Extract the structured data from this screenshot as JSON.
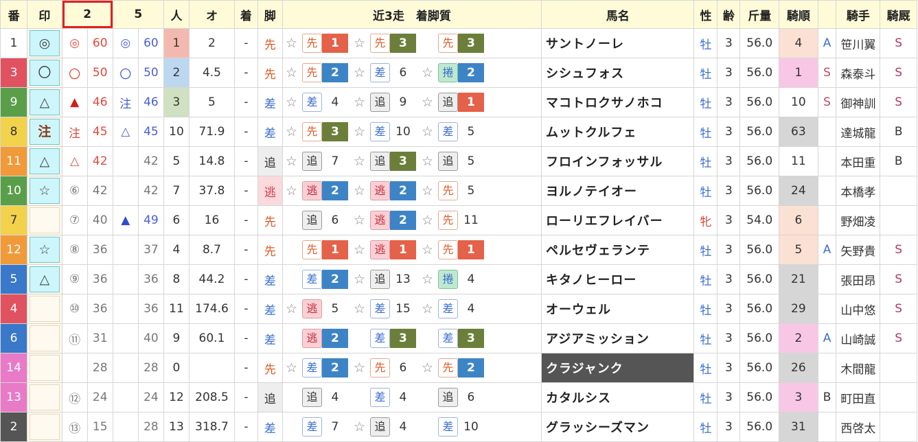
{
  "headers": {
    "ban": "番",
    "in": "印",
    "col2": "2",
    "col5": "5",
    "nin": "人",
    "odds": "オ",
    "chaku": "着",
    "kyaku": "脚",
    "recent": "近3走　着脚質",
    "horse": "馬名",
    "sex": "性",
    "age": "齢",
    "weight": "斤量",
    "rank": "騎順",
    "jockey": "騎手",
    "stable": "騎厩"
  },
  "rows": [
    {
      "ban": "1",
      "mark": "◎",
      "m2": "◎",
      "m2c": "red",
      "s2": "60",
      "m5": "◎",
      "m5c": "blue",
      "s5": "60",
      "pop": "1",
      "odds": "2",
      "chaku": "-",
      "leg": "先",
      "legc": "sen",
      "recent": [
        {
          "star": "☆",
          "style": "先",
          "sc": "sen",
          "pl": "1",
          "pc": "p1"
        },
        {
          "star": "☆",
          "style": "先",
          "sc": "sen",
          "pl": "3",
          "pc": "p3"
        },
        {
          "star": "",
          "style": "先",
          "sc": "sen",
          "pl": "3",
          "pc": "p3"
        }
      ],
      "horse": "サントノーレ",
      "sex": "牡",
      "age": "3",
      "weight": "56.0",
      "rank": "4",
      "rc": "o-peach",
      "letter": "A",
      "lc": "letA",
      "jockey": "笹川翼",
      "stable": "S",
      "stc": "stS"
    },
    {
      "ban": "3",
      "mark": "〇",
      "m2": "〇",
      "m2c": "red",
      "s2": "50",
      "m5": "〇",
      "m5c": "blue",
      "s5": "50",
      "pop": "2",
      "odds": "4.5",
      "chaku": "-",
      "leg": "先",
      "legc": "sen",
      "recent": [
        {
          "star": "☆",
          "style": "先",
          "sc": "sen",
          "pl": "2",
          "pc": "p2"
        },
        {
          "star": "☆",
          "style": "差",
          "sc": "sa",
          "pl": "6",
          "pc": ""
        },
        {
          "star": "☆",
          "style": "捲",
          "sc": "maki",
          "pl": "2",
          "pc": "p2"
        }
      ],
      "horse": "シシュフォス",
      "sex": "牡",
      "age": "3",
      "weight": "56.0",
      "rank": "1",
      "rc": "o-pink",
      "letter": "S",
      "lc": "letS",
      "jockey": "森泰斗",
      "stable": "S",
      "stc": "stS"
    },
    {
      "ban": "9",
      "mark": "△",
      "m2": "▲",
      "m2c": "red",
      "s2": "46",
      "m5": "注",
      "m5c": "blue",
      "s5": "46",
      "pop": "3",
      "odds": "5",
      "chaku": "-",
      "leg": "差",
      "legc": "sa",
      "recent": [
        {
          "star": "☆",
          "style": "差",
          "sc": "sa",
          "pl": "4",
          "pc": ""
        },
        {
          "star": "☆",
          "style": "追",
          "sc": "tsui",
          "pl": "9",
          "pc": ""
        },
        {
          "star": "☆",
          "style": "追",
          "sc": "tsui",
          "pl": "1",
          "pc": "p1"
        }
      ],
      "horse": "マコトロクサノホコ",
      "sex": "牡",
      "age": "3",
      "weight": "56.0",
      "rank": "10",
      "rc": "",
      "letter": "S",
      "lc": "letS",
      "jockey": "御神訓",
      "stable": "S",
      "stc": "stS"
    },
    {
      "ban": "8",
      "mark": "注",
      "m2": "注",
      "m2c": "red",
      "s2": "45",
      "m5": "△",
      "m5c": "blue",
      "s5": "45",
      "pop": "10",
      "odds": "71.9",
      "chaku": "-",
      "leg": "差",
      "legc": "sa",
      "recent": [
        {
          "star": "☆",
          "style": "先",
          "sc": "sen",
          "pl": "3",
          "pc": "p3"
        },
        {
          "star": "☆",
          "style": "差",
          "sc": "sa",
          "pl": "10",
          "pc": ""
        },
        {
          "star": "☆",
          "style": "差",
          "sc": "sa",
          "pl": "5",
          "pc": ""
        }
      ],
      "horse": "ムットクルフェ",
      "sex": "牡",
      "age": "3",
      "weight": "56.0",
      "rank": "63",
      "rc": "o-gray",
      "letter": "",
      "lc": "letB",
      "jockey": "達城龍",
      "stable": "B",
      "stc": "stB"
    },
    {
      "ban": "11",
      "mark": "△",
      "m2": "△",
      "m2c": "red",
      "s2": "42",
      "m5": "",
      "m5c": "blue",
      "s5": "42",
      "pop": "5",
      "odds": "14.8",
      "chaku": "-",
      "leg": "追",
      "legc": "tsui",
      "recent": [
        {
          "star": "☆",
          "style": "追",
          "sc": "tsui",
          "pl": "7",
          "pc": ""
        },
        {
          "star": "☆",
          "style": "追",
          "sc": "tsui",
          "pl": "3",
          "pc": "p3"
        },
        {
          "star": "☆",
          "style": "追",
          "sc": "tsui",
          "pl": "5",
          "pc": ""
        }
      ],
      "horse": "フロインフォッサル",
      "sex": "牡",
      "age": "3",
      "weight": "56.0",
      "rank": "11",
      "rc": "",
      "letter": "",
      "lc": "letB",
      "jockey": "本田重",
      "stable": "B",
      "stc": "stB"
    },
    {
      "ban": "10",
      "mark": "☆",
      "m2": "⑥",
      "m2c": "gray",
      "s2": "42",
      "m5": "",
      "m5c": "blue",
      "s5": "42",
      "pop": "7",
      "odds": "37.8",
      "chaku": "-",
      "leg": "逃",
      "legc": "nige",
      "recent": [
        {
          "star": "☆",
          "style": "逃",
          "sc": "nige",
          "pl": "2",
          "pc": "p2"
        },
        {
          "star": "☆",
          "style": "逃",
          "sc": "nige",
          "pl": "2",
          "pc": "p2"
        },
        {
          "star": "☆",
          "style": "先",
          "sc": "sen",
          "pl": "5",
          "pc": ""
        }
      ],
      "horse": "ヨルノテイオー",
      "sex": "牡",
      "age": "3",
      "weight": "56.0",
      "rank": "24",
      "rc": "o-gray",
      "letter": "",
      "lc": "letB",
      "jockey": "本橋孝",
      "stable": "",
      "stc": "stB"
    },
    {
      "ban": "7",
      "mark": "",
      "m2": "⑦",
      "m2c": "gray",
      "s2": "40",
      "m5": "▲",
      "m5c": "blue",
      "s5": "49",
      "pop": "6",
      "odds": "16",
      "chaku": "-",
      "leg": "先",
      "legc": "sen",
      "recent": [
        {
          "star": "",
          "style": "追",
          "sc": "tsui",
          "pl": "6",
          "pc": ""
        },
        {
          "star": "☆",
          "style": "逃",
          "sc": "nige",
          "pl": "2",
          "pc": "p2"
        },
        {
          "star": "☆",
          "style": "先",
          "sc": "sen",
          "pl": "11",
          "pc": ""
        }
      ],
      "horse": "ローリエフレイバー",
      "sex": "牝",
      "age": "3",
      "weight": "54.0",
      "rank": "6",
      "rc": "o-peach",
      "letter": "",
      "lc": "letB",
      "jockey": "野畑凌",
      "stable": "",
      "stc": "stB"
    },
    {
      "ban": "12",
      "mark": "☆",
      "m2": "⑧",
      "m2c": "gray",
      "s2": "36",
      "m5": "",
      "m5c": "blue",
      "s5": "37",
      "pop": "4",
      "odds": "8.7",
      "chaku": "-",
      "leg": "先",
      "legc": "sen",
      "recent": [
        {
          "star": "",
          "style": "先",
          "sc": "sen",
          "pl": "1",
          "pc": "p1"
        },
        {
          "star": "☆",
          "style": "逃",
          "sc": "nige",
          "pl": "1",
          "pc": "p1"
        },
        {
          "star": "☆",
          "style": "先",
          "sc": "sen",
          "pl": "1",
          "pc": "p1"
        }
      ],
      "horse": "ペルセヴェランテ",
      "sex": "牡",
      "age": "3",
      "weight": "56.0",
      "rank": "5",
      "rc": "o-peach",
      "letter": "A",
      "lc": "letA",
      "jockey": "矢野貴",
      "stable": "S",
      "stc": "stS"
    },
    {
      "ban": "5",
      "mark": "△",
      "m2": "⑨",
      "m2c": "gray",
      "s2": "36",
      "m5": "",
      "m5c": "blue",
      "s5": "36",
      "pop": "8",
      "odds": "44.2",
      "chaku": "-",
      "leg": "差",
      "legc": "sa",
      "recent": [
        {
          "star": "",
          "style": "差",
          "sc": "sa",
          "pl": "2",
          "pc": "p2"
        },
        {
          "star": "☆",
          "style": "追",
          "sc": "tsui",
          "pl": "13",
          "pc": ""
        },
        {
          "star": "☆",
          "style": "捲",
          "sc": "maki",
          "pl": "4",
          "pc": ""
        }
      ],
      "horse": "キタノヒーロー",
      "sex": "牡",
      "age": "3",
      "weight": "56.0",
      "rank": "21",
      "rc": "o-gray",
      "letter": "",
      "lc": "letB",
      "jockey": "張田昂",
      "stable": "S",
      "stc": "stS"
    },
    {
      "ban": "4",
      "mark": "",
      "m2": "⑩",
      "m2c": "gray",
      "s2": "36",
      "m5": "",
      "m5c": "blue",
      "s5": "36",
      "pop": "11",
      "odds": "174.6",
      "chaku": "-",
      "leg": "差",
      "legc": "sa",
      "recent": [
        {
          "star": "☆",
          "style": "逃",
          "sc": "nige",
          "pl": "5",
          "pc": ""
        },
        {
          "star": "☆",
          "style": "差",
          "sc": "sa",
          "pl": "15",
          "pc": ""
        },
        {
          "star": "☆",
          "style": "差",
          "sc": "sa",
          "pl": "4",
          "pc": ""
        }
      ],
      "horse": "オーウェル",
      "sex": "牡",
      "age": "3",
      "weight": "56.0",
      "rank": "29",
      "rc": "o-gray",
      "letter": "",
      "lc": "letB",
      "jockey": "山中悠",
      "stable": "S",
      "stc": "stS"
    },
    {
      "ban": "6",
      "mark": "",
      "m2": "⑪",
      "m2c": "gray",
      "s2": "31",
      "m5": "",
      "m5c": "blue",
      "s5": "40",
      "pop": "9",
      "odds": "60.1",
      "chaku": "-",
      "leg": "差",
      "legc": "sa",
      "recent": [
        {
          "star": "",
          "style": "逃",
          "sc": "nige",
          "pl": "2",
          "pc": "p2"
        },
        {
          "star": "",
          "style": "差",
          "sc": "sa",
          "pl": "3",
          "pc": "p3"
        },
        {
          "star": "",
          "style": "差",
          "sc": "sa",
          "pl": "3",
          "pc": "p3"
        }
      ],
      "horse": "アジアミッション",
      "sex": "牡",
      "age": "3",
      "weight": "56.0",
      "rank": "2",
      "rc": "o-pink",
      "letter": "A",
      "lc": "letA",
      "jockey": "山崎誠",
      "stable": "S",
      "stc": "stS"
    },
    {
      "ban": "14",
      "mark": "",
      "m2": "",
      "m2c": "gray",
      "s2": "28",
      "m5": "",
      "m5c": "blue",
      "s5": "28",
      "pop": "0",
      "odds": "",
      "chaku": "-",
      "leg": "先",
      "legc": "sen",
      "recent": [
        {
          "star": "☆",
          "style": "差",
          "sc": "sa",
          "pl": "2",
          "pc": "p2"
        },
        {
          "star": "☆",
          "style": "先",
          "sc": "sen",
          "pl": "6",
          "pc": ""
        },
        {
          "star": "☆",
          "style": "先",
          "sc": "sen",
          "pl": "2",
          "pc": "p2"
        }
      ],
      "horse": "クラジャンク",
      "sex": "牡",
      "age": "3",
      "weight": "56.0",
      "rank": "26",
      "rc": "o-gray",
      "letter": "",
      "lc": "letB",
      "jockey": "木間龍",
      "stable": "",
      "stc": "stB",
      "dark": true
    },
    {
      "ban": "13",
      "mark": "",
      "m2": "⑫",
      "m2c": "gray",
      "s2": "24",
      "m5": "",
      "m5c": "blue",
      "s5": "24",
      "pop": "12",
      "odds": "208.5",
      "chaku": "-",
      "leg": "追",
      "legc": "tsui",
      "recent": [
        {
          "star": "",
          "style": "追",
          "sc": "tsui",
          "pl": "4",
          "pc": ""
        },
        {
          "star": "",
          "style": "差",
          "sc": "sa",
          "pl": "4",
          "pc": ""
        },
        {
          "star": "",
          "style": "追",
          "sc": "tsui",
          "pl": "6",
          "pc": ""
        }
      ],
      "horse": "カタルシス",
      "sex": "牡",
      "age": "3",
      "weight": "56.0",
      "rank": "3",
      "rc": "o-pink",
      "letter": "B",
      "lc": "letB",
      "jockey": "町田直",
      "stable": "",
      "stc": "stB"
    },
    {
      "ban": "2",
      "mark": "",
      "m2": "⑬",
      "m2c": "gray",
      "s2": "15",
      "m5": "",
      "m5c": "blue",
      "s5": "28",
      "pop": "13",
      "odds": "318.7",
      "chaku": "-",
      "leg": "差",
      "legc": "sa",
      "recent": [
        {
          "star": "",
          "style": "差",
          "sc": "sa",
          "pl": "7",
          "pc": ""
        },
        {
          "star": "☆",
          "style": "追",
          "sc": "tsui",
          "pl": "4",
          "pc": ""
        },
        {
          "star": "",
          "style": "差",
          "sc": "sa",
          "pl": "10",
          "pc": ""
        }
      ],
      "horse": "グラッシーズマン",
      "sex": "牡",
      "age": "3",
      "weight": "56.0",
      "rank": "31",
      "rc": "o-gray",
      "letter": "",
      "lc": "letB",
      "jockey": "西啓太",
      "stable": "",
      "stc": "stB"
    }
  ]
}
